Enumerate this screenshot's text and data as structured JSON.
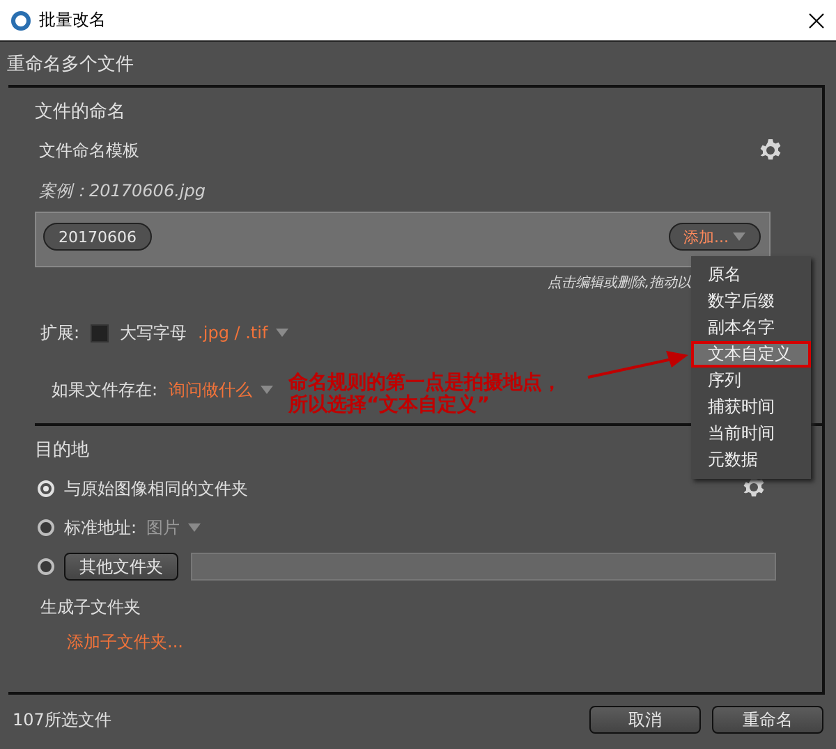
{
  "window": {
    "title": "批量改名"
  },
  "dialog_heading": "重命名多个文件",
  "naming": {
    "heading": "文件的命名",
    "template_label": "文件命名模板",
    "example": "案例：20170606.jpg",
    "tokens": [
      {
        "label": "20170606"
      }
    ],
    "add_button": "添加...",
    "hint": "点击编辑或删除,拖动以",
    "extension": {
      "label": "扩展:",
      "uppercase": {
        "label": "大写字母",
        "checked": false
      },
      "value": ".jpg / .tif"
    },
    "if_exists": {
      "label": "如果文件存在:",
      "value": "询问做什么"
    }
  },
  "add_menu": {
    "items": [
      {
        "label": "原名",
        "selected": false
      },
      {
        "label": "数字后缀",
        "selected": false
      },
      {
        "label": "副本名字",
        "selected": false
      },
      {
        "label": "文本自定义",
        "selected": true
      },
      {
        "label": "序列",
        "selected": false
      },
      {
        "label": "捕获时间",
        "selected": false
      },
      {
        "label": "当前时间",
        "selected": false
      },
      {
        "label": "元数据",
        "selected": false
      }
    ]
  },
  "annotation": {
    "lines": [
      "命名规则的第一点是拍摄地点，",
      "所以选择“文本自定义”"
    ]
  },
  "destination": {
    "heading": "目的地",
    "options": [
      {
        "kind": "plain",
        "label": "与原始图像相同的文件夹",
        "selected": true
      },
      {
        "kind": "dropdown",
        "label": "标准地址:",
        "value": "图片",
        "selected": false
      },
      {
        "kind": "folder",
        "label": "其他文件夹",
        "selected": false
      }
    ],
    "subfolder_label": "生成子文件夹",
    "add_subfolder": "添加子文件夹..."
  },
  "footer": {
    "count": "107所选文件",
    "buttons": [
      "取消",
      "重命名"
    ]
  }
}
